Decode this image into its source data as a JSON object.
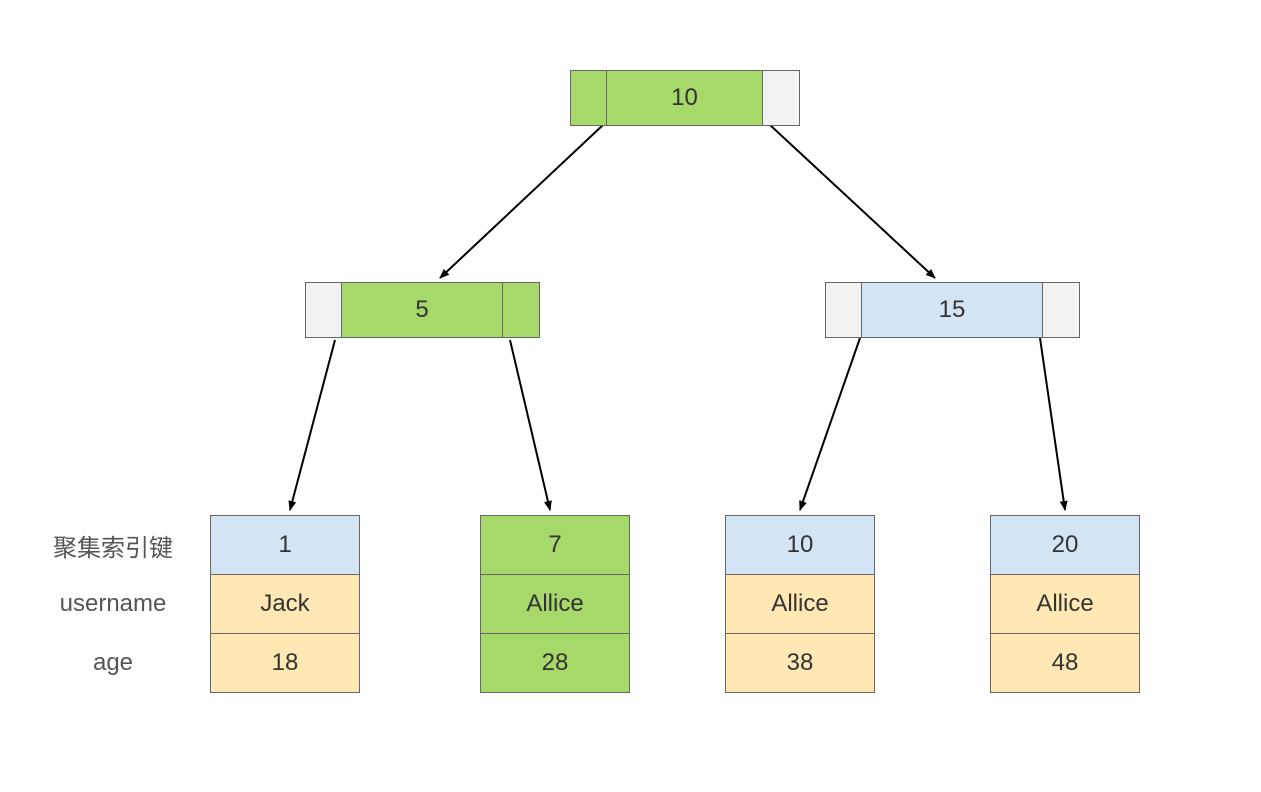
{
  "labels": {
    "index_key": "聚集索引键",
    "username": "username",
    "age": "age"
  },
  "tree": {
    "root": {
      "key": "10"
    },
    "mid_left": {
      "key": "5"
    },
    "mid_right": {
      "key": "15"
    },
    "leaves": [
      {
        "key": "1",
        "username": "Jack",
        "age": "18"
      },
      {
        "key": "7",
        "username": "Allice",
        "age": "28"
      },
      {
        "key": "10",
        "username": "Allice",
        "age": "38"
      },
      {
        "key": "20",
        "username": "Allice",
        "age": "48"
      }
    ]
  }
}
